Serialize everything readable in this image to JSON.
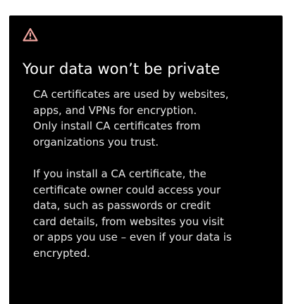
{
  "dialog": {
    "icon": "warning-triangle-icon",
    "icon_color": "#f2a7a1",
    "background": "#000000",
    "title": "Your data won’t be private",
    "paragraphs": [
      {
        "lines": [
          "CA certificates are used by websites,",
          "apps, and VPNs for encryption.",
          "Only install CA certificates from",
          "organizations you trust."
        ]
      },
      {
        "lines": [
          "If you install a CA certificate, the",
          "certificate owner could access your",
          "data, such as passwords or credit",
          "card details, from websites you visit",
          "or apps you use – even if your data is",
          "encrypted."
        ]
      }
    ]
  }
}
